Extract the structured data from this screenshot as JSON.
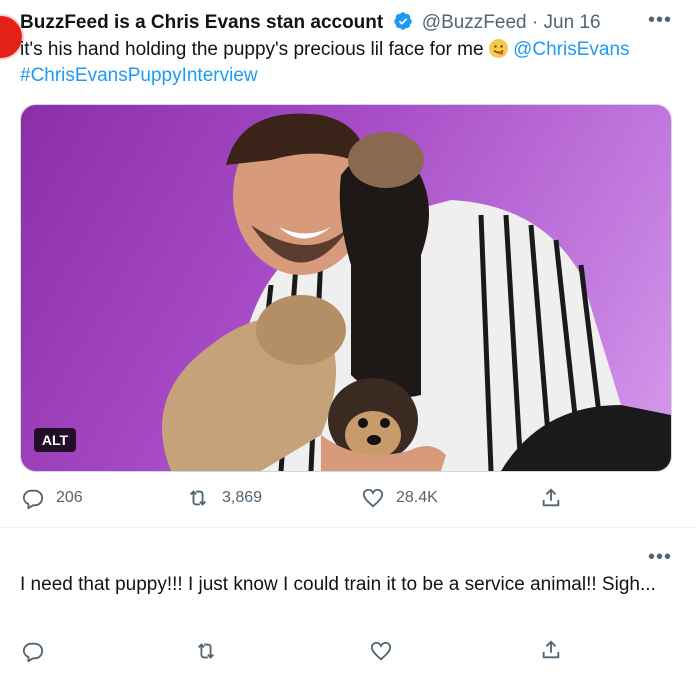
{
  "tweet": {
    "display_name": "BuzzFeed is a Chris Evans stan account",
    "handle": "@BuzzFeed",
    "separator": "·",
    "date": "Jun 16",
    "text_before": "it's his hand holding the puppy's precious lil face for me ",
    "mention": "@ChrisEvans",
    "hashtag": "#ChrisEvansPuppyInterview",
    "media_alt_badge": "ALT",
    "more": "•••",
    "actions": {
      "reply_count": "206",
      "retweet_count": "3,869",
      "like_count": "28.4K"
    }
  },
  "reply": {
    "more": "•••",
    "text": "I need that puppy!!! I just know I could train it to be a service animal!! Sigh..."
  },
  "colors": {
    "accent": "#1d9bf0",
    "verified": "#1d9bf0",
    "muted_text": "#536471",
    "media_background": "#a64bc5"
  }
}
